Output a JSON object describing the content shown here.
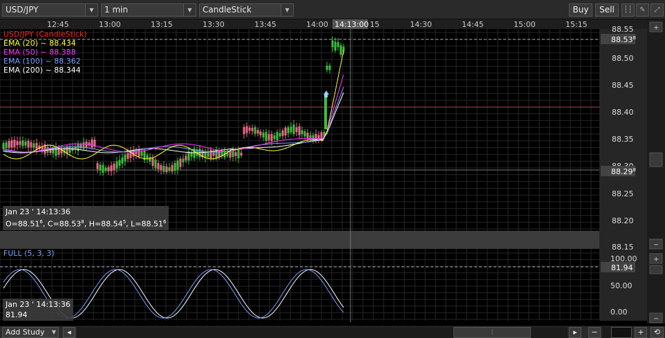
{
  "toolbar": {
    "symbol": "USD/JPY",
    "interval": "1 min",
    "chart_type": "CandleStick",
    "buy_label": "Buy",
    "sell_label": "Sell"
  },
  "time_axis": {
    "labels": [
      "12:45",
      "13:00",
      "13:15",
      "13:30",
      "13:45",
      "14:00",
      "14:13:00",
      "15",
      "14:30",
      "14:45",
      "15:00",
      "15:15"
    ],
    "crosshair_label": "14:13:00"
  },
  "price_axis": {
    "labels": [
      "88.55",
      "88.50",
      "88.45",
      "88.40",
      "88.35",
      "88.30",
      "88.25",
      "88.20",
      "88.15"
    ],
    "current_price": "88.53",
    "current_price_sup": "8",
    "crosshair_price": "88.29",
    "crosshair_price_sup": "8"
  },
  "legend": {
    "main": "USD/JPY (CandleStick)",
    "ema20": "EMA (20) ~ 88.434",
    "ema50": "EMA (50) ~ 88.388",
    "ema100": "EMA (100) ~ 88.362",
    "ema200": "EMA (200) ~ 88.344"
  },
  "colors": {
    "ema20": "#ffff33",
    "ema50": "#ff33ff",
    "ema100": "#7a9cff",
    "ema200": "#ffffff",
    "candle_up": "#3cbf3c",
    "candle_down": "#e86a8a",
    "main_legend": "#ff2222"
  },
  "main_info": {
    "date": "Jan 23 ' 14:13:36",
    "ohlc": "O=88.51",
    "ohlc_o_sup": "6",
    "ohlc_c": ", C=88.53",
    "ohlc_c_sup": "8",
    "ohlc_h": ", H=88.54",
    "ohlc_h_sup": "5",
    "ohlc_l": ", L=88.51",
    "ohlc_l_sup": "6"
  },
  "stoch": {
    "label": "FULL (5, 3, 3)",
    "axis_labels": [
      "100.00",
      "50.00",
      "0.00"
    ],
    "current": "81.94",
    "info_date": "Jan 23 ' 14:13:36",
    "info_value": "81.94"
  },
  "bottom": {
    "add_study": "Add Study"
  }
}
